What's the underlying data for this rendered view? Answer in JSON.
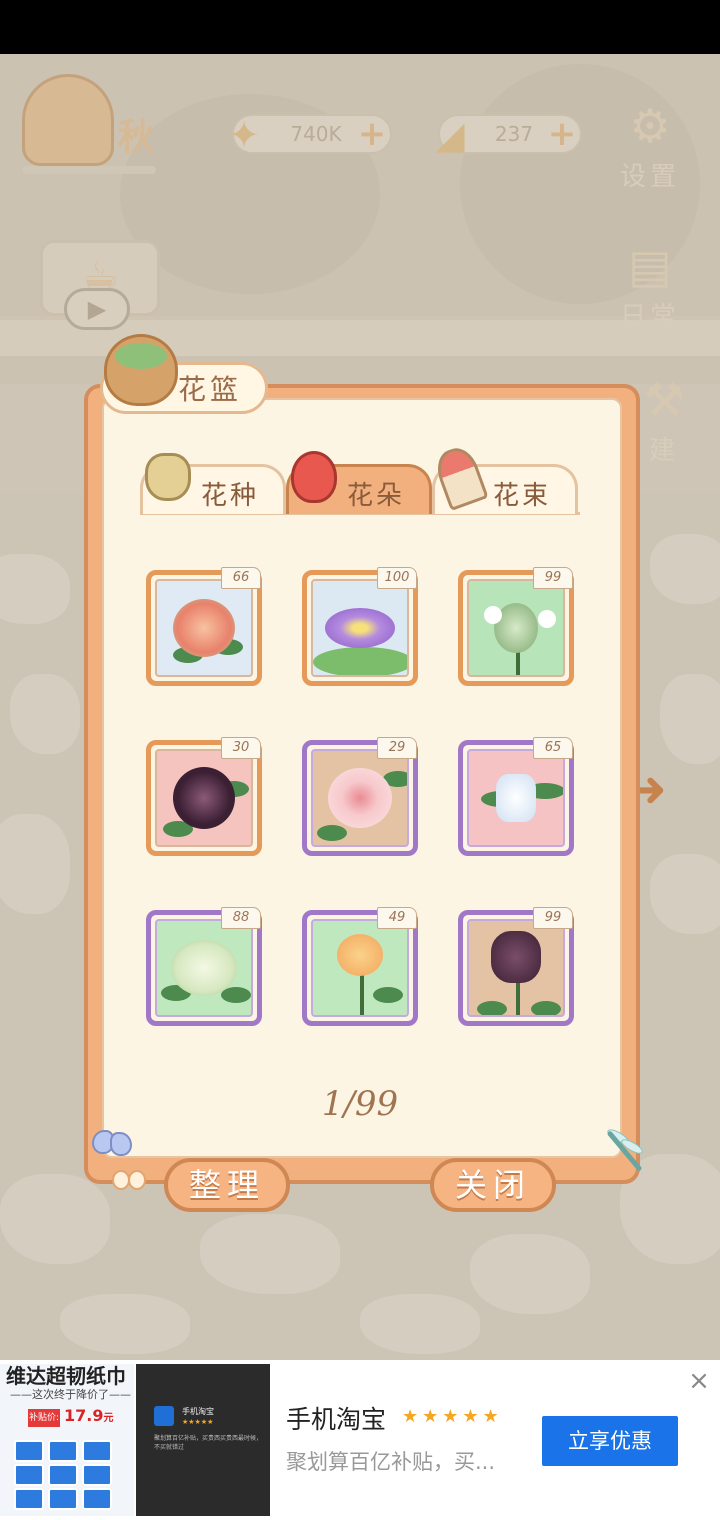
{
  "hud": {
    "season": "秋",
    "fish_value": "740K",
    "cheese_value": "237",
    "settings_label": "设置",
    "diary_label": "日常",
    "build_label": "建"
  },
  "panel": {
    "title": "花篮",
    "tabs": [
      {
        "label": "花种",
        "icon": "seed-bag-icon",
        "active": false
      },
      {
        "label": "花朵",
        "icon": "rose-icon",
        "active": true
      },
      {
        "label": "花束",
        "icon": "bouquet-icon",
        "active": false
      }
    ],
    "items": [
      {
        "count": "66",
        "frame": "orange"
      },
      {
        "count": "100",
        "frame": "orange"
      },
      {
        "count": "99",
        "frame": "orange"
      },
      {
        "count": "30",
        "frame": "orange"
      },
      {
        "count": "29",
        "frame": "purple"
      },
      {
        "count": "65",
        "frame": "purple"
      },
      {
        "count": "88",
        "frame": "purple"
      },
      {
        "count": "49",
        "frame": "purple"
      },
      {
        "count": "99",
        "frame": "purple"
      }
    ],
    "page": "1/99",
    "organize_label": "整理",
    "close_label": "关闭"
  },
  "ad": {
    "image1_title": "维达超韧纸巾",
    "image1_subtitle": "——这次终于降价了——",
    "image1_price_tag": "补贴价:",
    "image1_price": "17.9",
    "image1_price_unit": "元",
    "image2_name": "手机淘宝",
    "image2_stars": "★★★★★",
    "image2_desc": "聚划算百亿补贴，买贵西买贵西最时候，不买就错过",
    "app_name": "手机淘宝",
    "stars": "★★★★★",
    "description": "聚划算百亿补贴，买...",
    "cta": "立享优惠",
    "close": "×"
  },
  "colors": {
    "panel_bg": "#fdf5e4",
    "panel_border": "#f2b07e",
    "orange_frame": "#e59a5a",
    "purple_frame": "#a178c8",
    "cta_blue": "#1a73e8"
  }
}
